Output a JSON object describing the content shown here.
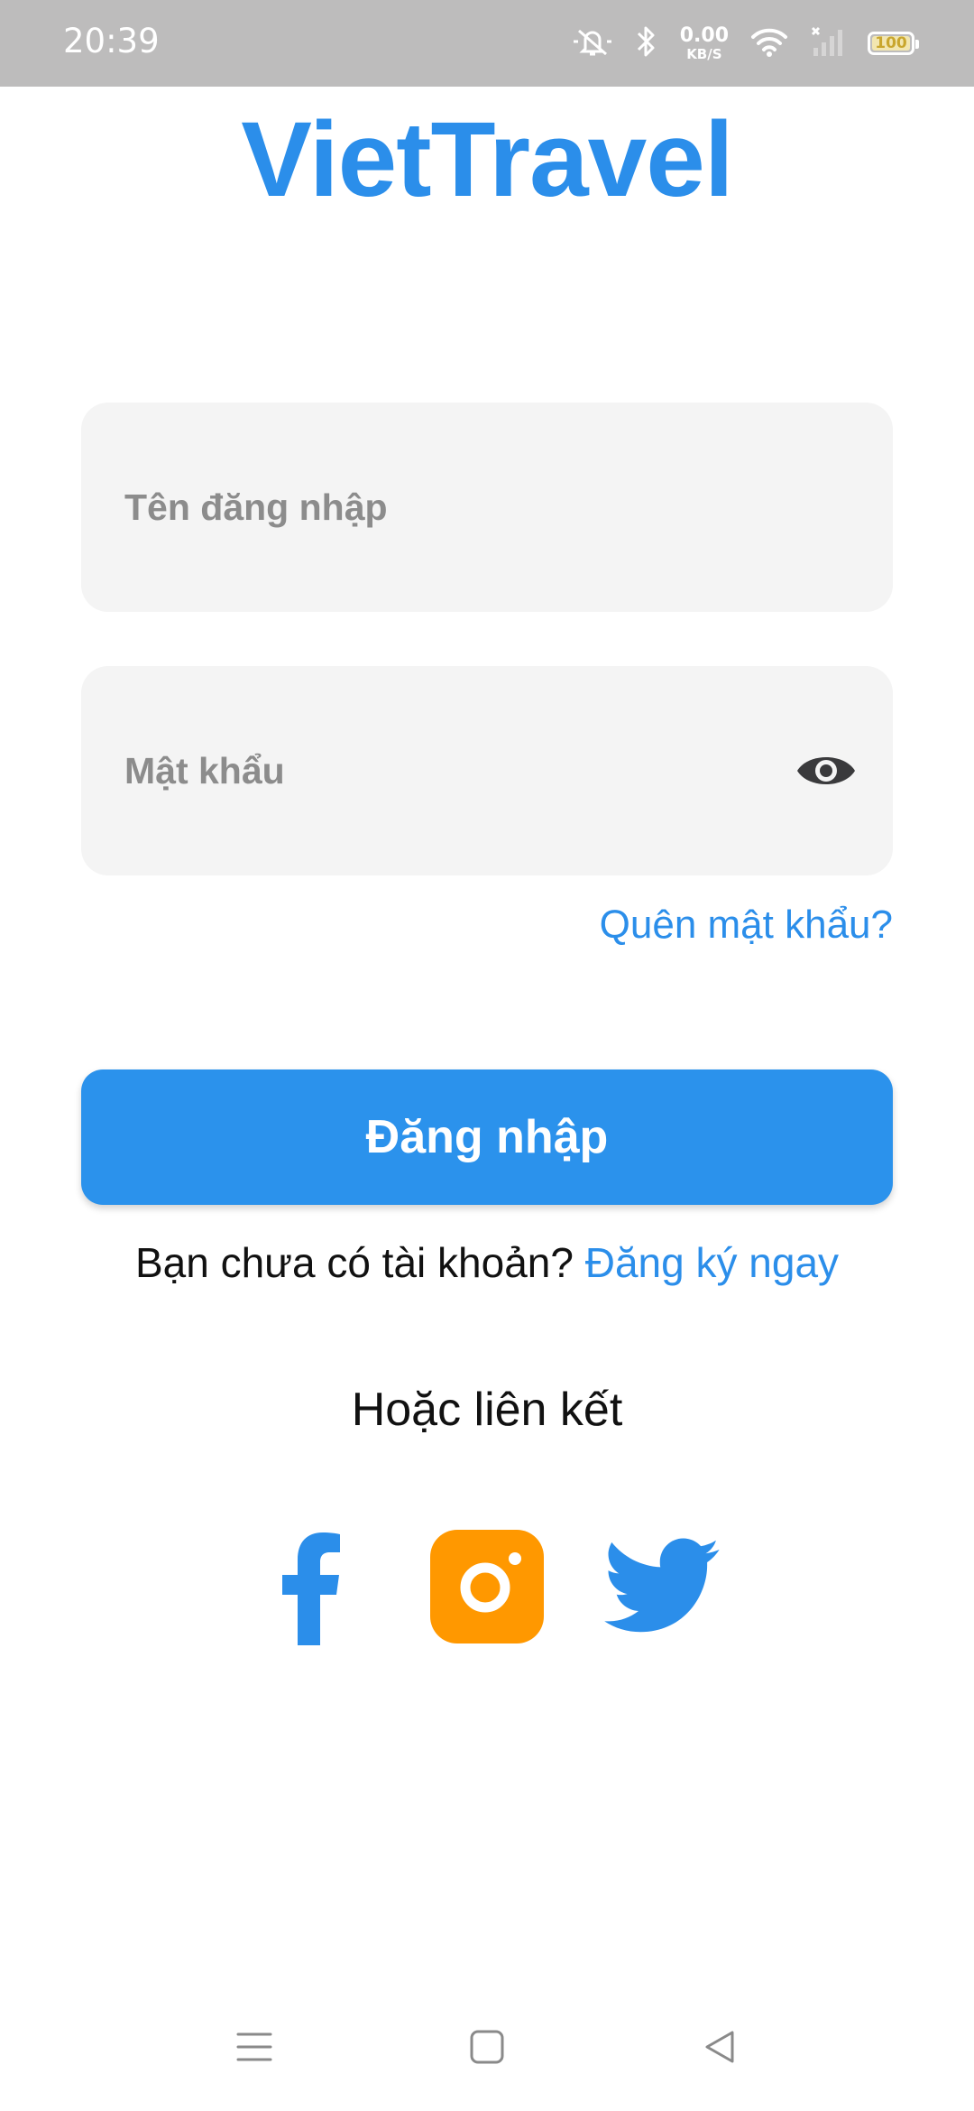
{
  "status_bar": {
    "time": "20:39",
    "net_speed_value": "0.00",
    "net_speed_unit": "KB/S",
    "battery_level": "100",
    "icons": [
      "mute-icon",
      "bluetooth-icon",
      "wifi-icon",
      "no-signal-icon",
      "battery-icon"
    ]
  },
  "app": {
    "title": "VietTravel"
  },
  "login_form": {
    "username_placeholder": "Tên đăng nhập",
    "username_value": "",
    "password_placeholder": "Mật khẩu",
    "password_value": "",
    "forgot_password_label": "Quên mật khẩu?",
    "login_button_label": "Đăng nhập",
    "register_prompt": "Bạn chưa có tài khoản?",
    "register_link_label": "Đăng ký ngay"
  },
  "social": {
    "label": "Hoặc liên kết",
    "providers": [
      "facebook-icon",
      "instagram-icon",
      "twitter-icon"
    ]
  },
  "colors": {
    "accent": "#2b8eea",
    "button": "#2b92ec",
    "instagram": "#ff9800",
    "field_background": "#f4f4f4",
    "status_bar": "#bdbcbc"
  }
}
